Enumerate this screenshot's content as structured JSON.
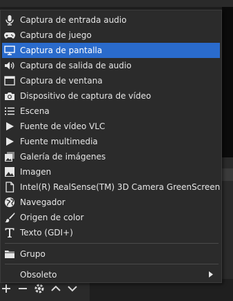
{
  "menu": {
    "items": [
      {
        "label": "Captura de entrada audio",
        "icon": "microphone-icon",
        "selected": false
      },
      {
        "label": "Captura de juego",
        "icon": "gamepad-icon",
        "selected": false
      },
      {
        "label": "Captura de pantalla",
        "icon": "monitor-icon",
        "selected": true
      },
      {
        "label": "Captura de salida de audio",
        "icon": "speaker-icon",
        "selected": false
      },
      {
        "label": "Captura de ventana",
        "icon": "window-icon",
        "selected": false
      },
      {
        "label": "Dispositivo de captura de vídeo",
        "icon": "camera-icon",
        "selected": false
      },
      {
        "label": "Escena",
        "icon": "list-icon",
        "selected": false
      },
      {
        "label": "Fuente de vídeo VLC",
        "icon": "play-icon",
        "selected": false
      },
      {
        "label": "Fuente multimedia",
        "icon": "play-icon",
        "selected": false
      },
      {
        "label": "Galería de imágenes",
        "icon": "image-gallery-icon",
        "selected": false
      },
      {
        "label": "Imagen",
        "icon": "image-icon",
        "selected": false
      },
      {
        "label": "Intel(R) RealSense(TM) 3D Camera GreenScreen",
        "icon": "file-icon",
        "selected": false
      },
      {
        "label": "Navegador",
        "icon": "globe-icon",
        "selected": false
      },
      {
        "label": "Origen de color",
        "icon": "brush-icon",
        "selected": false
      },
      {
        "label": "Texto (GDI+)",
        "icon": "text-icon",
        "selected": false
      }
    ],
    "group": {
      "label": "Grupo",
      "icon": "folder-icon"
    },
    "deprecated": {
      "label": "Obsoleto",
      "has_submenu": true
    }
  },
  "colors": {
    "menu_bg": "#2b2b2b",
    "selected_bg": "#2a6bcc",
    "text": "#e6e6e6"
  },
  "toolbar": {
    "buttons": [
      "add-icon",
      "remove-icon",
      "gear-icon",
      "chevron-up-icon",
      "chevron-down-icon"
    ]
  }
}
